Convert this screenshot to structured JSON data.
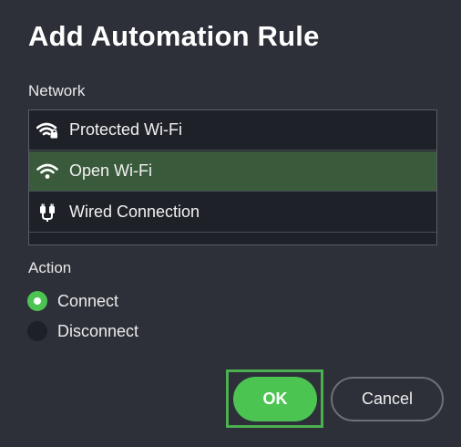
{
  "dialog": {
    "title": "Add Automation Rule"
  },
  "network": {
    "label": "Network",
    "items": [
      {
        "label": "Protected Wi-Fi",
        "icon": "wifi-lock-icon",
        "selected": false
      },
      {
        "label": "Open Wi-Fi",
        "icon": "wifi-icon",
        "selected": true
      },
      {
        "label": "Wired Connection",
        "icon": "ethernet-plug-icon",
        "selected": false
      }
    ]
  },
  "action": {
    "label": "Action",
    "options": [
      {
        "label": "Connect",
        "checked": true
      },
      {
        "label": "Disconnect",
        "checked": false
      }
    ]
  },
  "buttons": {
    "ok_label": "OK",
    "cancel_label": "Cancel"
  },
  "colors": {
    "background": "#2d3039",
    "selected_row": "#3a5a3c",
    "accent_green": "#4cc452",
    "focus_outline": "#4caf50"
  }
}
